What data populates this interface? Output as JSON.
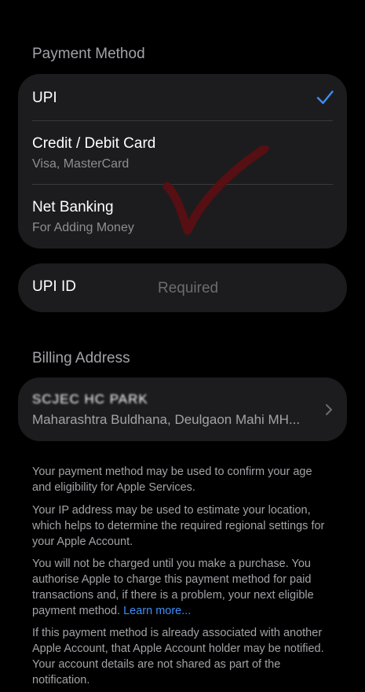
{
  "payment_method": {
    "title": "Payment Method",
    "options": [
      {
        "title": "UPI",
        "subtitle": "",
        "selected": true
      },
      {
        "title": "Credit / Debit Card",
        "subtitle": "Visa, MasterCard",
        "selected": false
      },
      {
        "title": "Net Banking",
        "subtitle": "For Adding Money",
        "selected": false
      }
    ]
  },
  "upi_id": {
    "label": "UPI ID",
    "placeholder": "Required"
  },
  "billing_address": {
    "title": "Billing Address",
    "name_line": "SCJEC HC PARK",
    "address_line": "Maharashtra Buldhana, Deulgaon Mahi MH..."
  },
  "info": {
    "p1": "Your payment method may be used to confirm your age and eligibility for Apple Services.",
    "p2": "Your IP address may be used to estimate your location, which helps to determine the required regional settings for your Apple Account.",
    "p3": "You will not be charged until you make a purchase. You authorise Apple to charge this payment method for paid transactions and, if there is a problem, your next eligible payment method.",
    "p3_link": "Learn more...",
    "p4": "If this payment method is already associated with another Apple Account, that Apple Account holder may be notified. Your account details are not shared as part of the notification."
  },
  "colors": {
    "background": "#000000",
    "card": "#1c1c1e",
    "accent": "#3d8ef7",
    "secondary_text": "#a3a3a8"
  }
}
